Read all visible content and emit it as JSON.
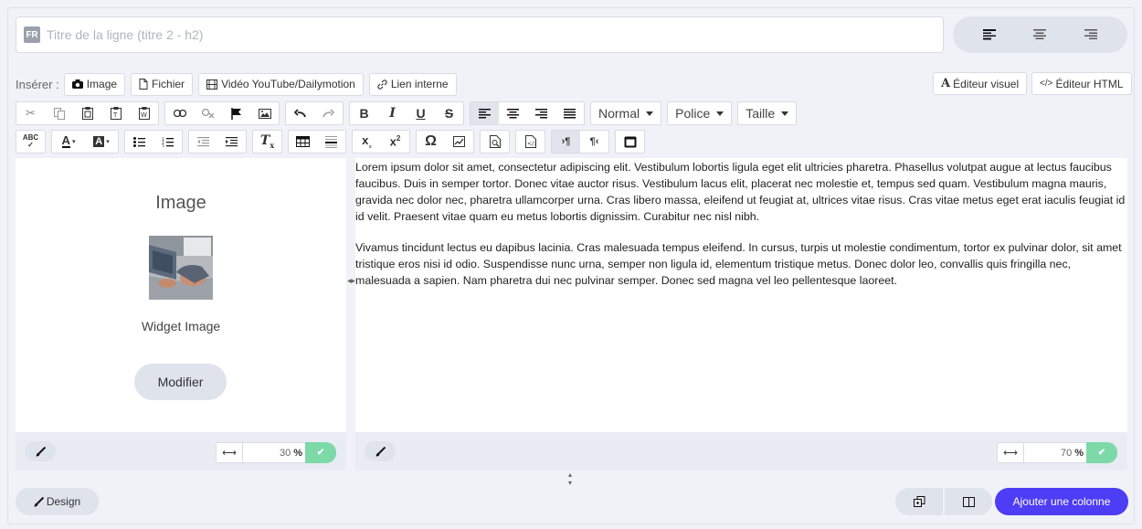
{
  "title_field": {
    "lang": "FR",
    "placeholder": "Titre de la ligne (titre 2 - h2)",
    "value": ""
  },
  "insert": {
    "label": "Insérer :",
    "image": "Image",
    "file": "Fichier",
    "video": "Vidéo YouTube/Dailymotion",
    "internal_link": "Lien interne"
  },
  "editor_modes": {
    "visual": "Éditeur visuel",
    "html": "Éditeur HTML"
  },
  "toolbar": {
    "format": "Normal",
    "font": "Police",
    "size": "Taille"
  },
  "left_column": {
    "widget_title": "Image",
    "widget_caption": "Widget Image",
    "modify_label": "Modifier",
    "width_value": "30",
    "width_unit": "%"
  },
  "right_column": {
    "paragraphs": [
      "Lorem ipsum dolor sit amet, consectetur adipiscing elit. Vestibulum lobortis ligula eget elit ultricies pharetra. Phasellus volutpat augue at lectus faucibus faucibus. Duis in semper tortor. Donec vitae auctor risus. Vestibulum lacus elit, placerat nec molestie et, tempus sed quam. Vestibulum magna mauris, gravida nec dolor nec, pharetra ullamcorper urna. Cras libero massa, eleifend ut feugiat at, ultrices vitae risus. Cras vitae metus eget erat iaculis feugiat id id velit. Praesent vitae quam eu metus lobortis dignissim. Curabitur nec nisl nibh.",
      "Vivamus tincidunt lectus eu dapibus lacinia. Cras malesuada tempus eleifend. In cursus, turpis ut molestie condimentum, tortor ex pulvinar dolor, sit amet tristique eros nisi id odio. Suspendisse nunc urna, semper non ligula id, elementum tristique metus. Donec dolor leo, convallis quis fringilla nec, malesuada a sapien. Nam pharetra dui nec pulvinar semper. Donec sed magna vel leo pellentesque laoreet."
    ],
    "width_value": "70",
    "width_unit": "%"
  },
  "bottom_bar": {
    "design_label": "Design",
    "add_column_label": "Ajouter une colonne"
  },
  "colors": {
    "accent": "#4d3df5",
    "confirm": "#7dd9a8",
    "panel_bg": "#f0f2f7"
  }
}
